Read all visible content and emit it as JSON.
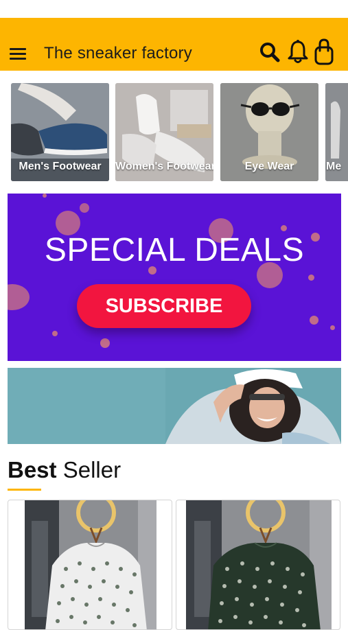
{
  "app": {
    "title": "The sneaker factory"
  },
  "header_icons": [
    "menu-icon",
    "search-icon",
    "bell-icon",
    "shopping-bag-icon"
  ],
  "categories": [
    {
      "label": "Men's Footwear"
    },
    {
      "label": "Women's Footwear"
    },
    {
      "label": "Eye Wear"
    },
    {
      "label": "Me"
    }
  ],
  "deals_banner": {
    "title": "SPECIAL DEALS",
    "button_label": "SUBSCRIBE"
  },
  "best_seller": {
    "title_bold": "Best",
    "title_rest": " Seller",
    "products": [
      {
        "image": "white-patterned-sweater"
      },
      {
        "image": "dark-green-patterned-sweater"
      }
    ]
  },
  "colors": {
    "app_bar": "#FDB501",
    "deals_background": "#5A13D6",
    "subscribe_button": "#F2153F",
    "accent_underline": "#FDB501"
  }
}
